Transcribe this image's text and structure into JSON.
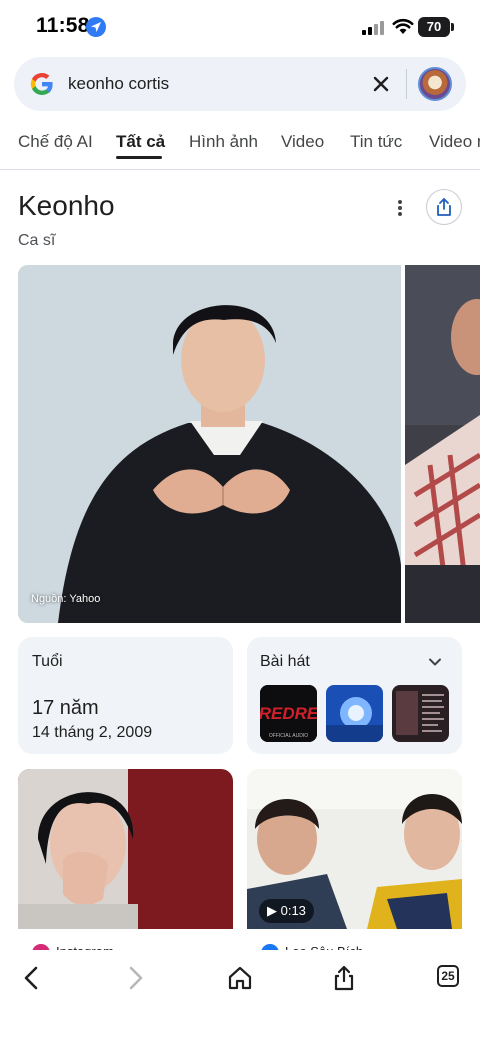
{
  "status_bar": {
    "time": "11:58",
    "battery": "70"
  },
  "search": {
    "query": "keonho cortis"
  },
  "tabs": [
    {
      "label": "Chế độ AI",
      "active": false
    },
    {
      "label": "Tất cả",
      "active": true
    },
    {
      "label": "Hình ảnh",
      "active": false
    },
    {
      "label": "Video",
      "active": false
    },
    {
      "label": "Tin tức",
      "active": false
    },
    {
      "label": "Video n",
      "active": false
    }
  ],
  "entity": {
    "title": "Keonho",
    "subtitle": "Ca sĩ",
    "image_source": "Nguồn: Yahoo"
  },
  "age_card": {
    "label": "Tuổi",
    "value": "17 năm",
    "birth_date": "14 tháng 2, 2009"
  },
  "songs_card": {
    "label": "Bài hát",
    "thumb_text": "REDRE",
    "thumb_subtext": "OFFICIAL AUDIO"
  },
  "results": [
    {
      "source": "Instagram",
      "video_duration": ""
    },
    {
      "source": "Leo Sâu Bích",
      "video_duration": "0:13"
    }
  ],
  "toolbar": {
    "tabs_count": "25"
  },
  "colors": {
    "accent_blue": "#2f7bf5",
    "search_bg": "#eef2f8",
    "card_bg": "#f0f3f7",
    "song_red": "#d0202a"
  }
}
